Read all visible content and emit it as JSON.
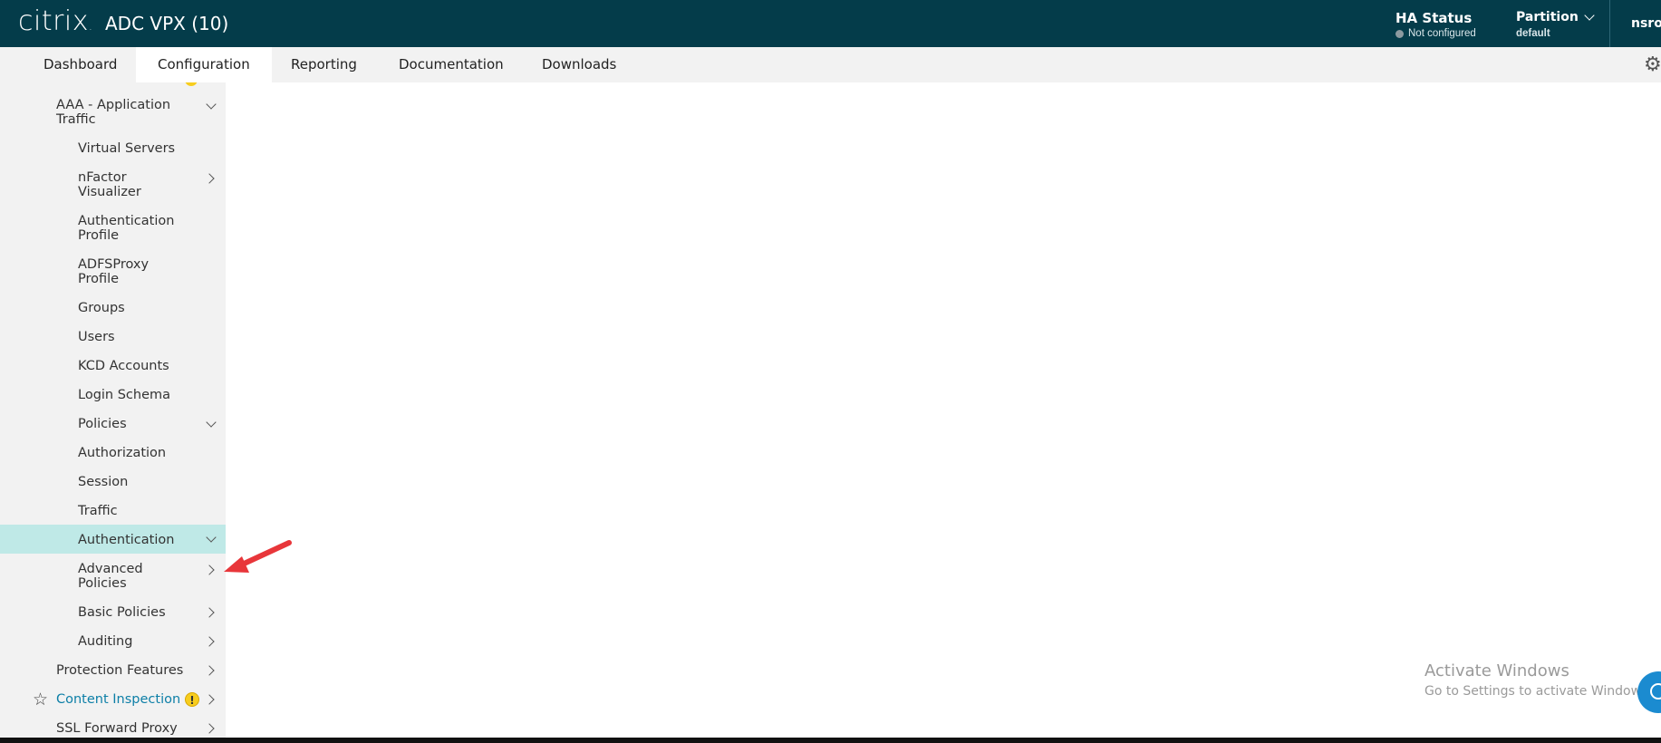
{
  "header": {
    "logo_text": "citrix",
    "title": "ADC VPX (10)",
    "ha_status_label": "HA Status",
    "ha_status_value": "Not configured",
    "partition_label": "Partition",
    "partition_value": "default",
    "user": "nsroot"
  },
  "nav": {
    "tabs": [
      {
        "label": "Dashboard"
      },
      {
        "label": "Configuration"
      },
      {
        "label": "Reporting"
      },
      {
        "label": "Documentation"
      },
      {
        "label": "Downloads"
      }
    ],
    "active_tab": "Configuration"
  },
  "sidebar": {
    "items": [
      {
        "label": "AAA - Application Traffic",
        "line1": "AAA - Application",
        "line2": "Traffic",
        "level": 1,
        "chevron": "down"
      },
      {
        "label": "Virtual Servers",
        "level": 2
      },
      {
        "label": "nFactor Visualizer",
        "line1": "nFactor",
        "line2": "Visualizer",
        "level": 2,
        "chevron": "right"
      },
      {
        "label": "Authentication Profile",
        "line1": "Authentication",
        "line2": "Profile",
        "level": 2
      },
      {
        "label": "ADFSProxy Profile",
        "line1": "ADFSProxy",
        "line2": "Profile",
        "level": 2
      },
      {
        "label": "Groups",
        "level": 2
      },
      {
        "label": "Users",
        "level": 2
      },
      {
        "label": "KCD Accounts",
        "level": 2
      },
      {
        "label": "Login Schema",
        "level": 2
      },
      {
        "label": "Policies",
        "level": 2,
        "chevron": "down"
      },
      {
        "label": "Authorization",
        "level": 2
      },
      {
        "label": "Session",
        "level": 2
      },
      {
        "label": "Traffic",
        "level": 2
      },
      {
        "label": "Authentication",
        "level": 2,
        "chevron": "down",
        "active": true
      },
      {
        "label": "Advanced Policies",
        "line1": "Advanced",
        "line2": "Policies",
        "level": 2,
        "chevron": "right"
      },
      {
        "label": "Basic Policies",
        "level": 2,
        "chevron": "right"
      },
      {
        "label": "Auditing",
        "level": 2,
        "chevron": "right"
      },
      {
        "label": "Protection Features",
        "level": 1,
        "chevron": "right"
      },
      {
        "label": "Content Inspection",
        "level": 1,
        "chevron": "right",
        "warning": "!"
      },
      {
        "label": "SSL Forward Proxy",
        "level": 1,
        "chevron": "right"
      }
    ]
  },
  "watermark": {
    "title": "Activate Windows",
    "subtitle": "Go to Settings to activate Windows."
  },
  "colors": {
    "header_bg": "#043c4a",
    "nav_bg": "#f2f2f2",
    "sidebar_active": "#bfe9e7",
    "link": "#0d7fa7",
    "warning": "#f7cd1e",
    "annotation_arrow": "#e8363a"
  },
  "icons": {
    "gear": "gear-icon",
    "favorite": "star-icon",
    "warning": "warning-icon",
    "help": "help-fab-icon"
  }
}
